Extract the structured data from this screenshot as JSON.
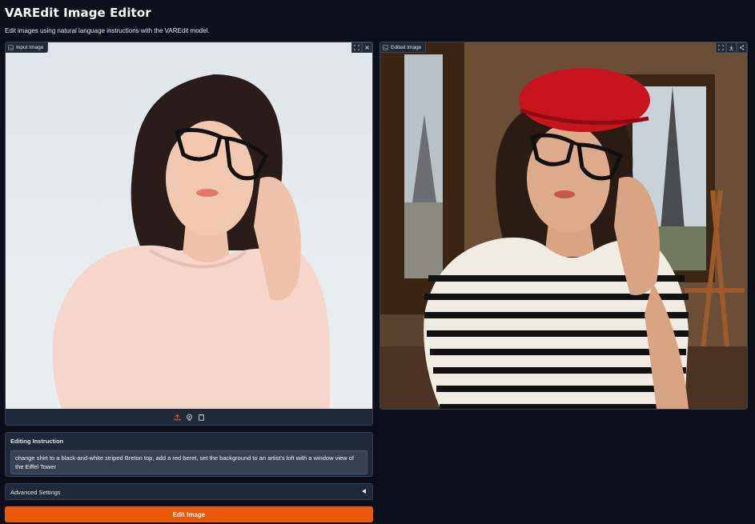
{
  "app": {
    "title": "VAREdit Image Editor",
    "subtitle": "Edit images using natural language instructions with the VAREdit model."
  },
  "input_panel": {
    "label": "Input Image",
    "icon": "image-icon",
    "corner_buttons": [
      "fullscreen-icon",
      "close-icon"
    ],
    "toolbar_icons": [
      "upload-icon",
      "webcam-icon",
      "clipboard-icon"
    ]
  },
  "output_panel": {
    "label": "Edited Image",
    "icon": "image-icon",
    "corner_buttons": [
      "fullscreen-icon",
      "download-icon",
      "share-icon"
    ]
  },
  "instruction": {
    "label": "Editing Instruction",
    "value": "change shirt to a black-and-white striped Breton top, add a red beret, set the background to an artist's loft with a window view of the Eiffel Tower"
  },
  "advanced": {
    "label": "Advanced Settings",
    "expanded": false
  },
  "edit_button": {
    "label": "Edit Image"
  },
  "colors": {
    "background": "#0b0f19",
    "panel": "#1f2937",
    "accent": "#ea580c"
  }
}
